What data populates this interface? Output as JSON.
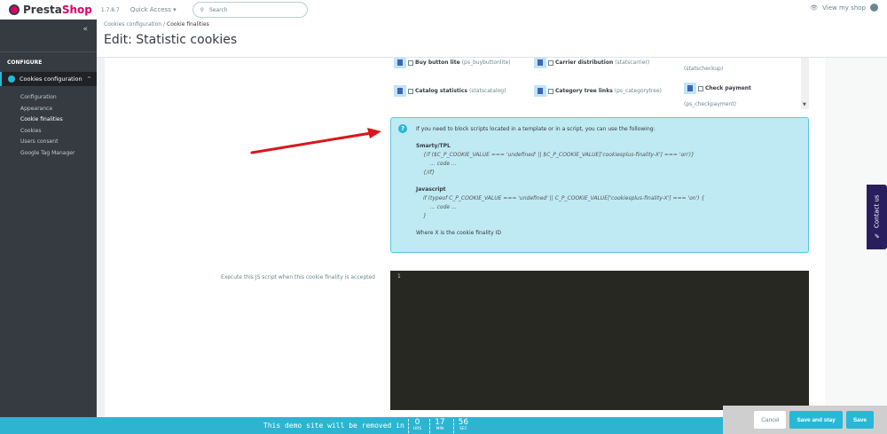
{
  "topbar": {
    "brand_a": "Presta",
    "brand_b": "Shop",
    "version": "1.7.8.7",
    "quick_access": "Quick Access ▾",
    "search_placeholder": "Search",
    "view_shop": "View my shop"
  },
  "sidebar": {
    "section": "CONFIGURE",
    "active": "Cookies configuration",
    "items": [
      "Configuration",
      "Appearance",
      "Cookie finalities",
      "Cookies",
      "Users consent",
      "Google Tag Manager"
    ]
  },
  "header": {
    "breadcrumb": [
      "Cookies configuration",
      "Cookie finalities"
    ],
    "title": "Edit: Statistic cookies"
  },
  "modules": [
    {
      "name": "Buy button lite",
      "code": "(ps_buybuttonlite)"
    },
    {
      "name": "Carrier distribution",
      "code": "(statscarrier)"
    },
    {
      "name": "",
      "code": "(statscheckup)"
    },
    {
      "name": "Catalog statistics",
      "code": "(statscatalog)"
    },
    {
      "name": "Category tree links",
      "code": "(ps_categorytree)"
    },
    {
      "name": "Check payment",
      "code": "(ps_checkpayment)"
    }
  ],
  "info": {
    "intro": "If you need to block scripts located in a template or in a script, you can use the following:",
    "smarty_title": "Smarty/TPL",
    "smarty_l1": "{if ($C_P_COOKIE_VALUE === 'undefined' || $C_P_COOKIE_VALUE['cookiesplus-finality-X'] === 'on')}",
    "smarty_l2": "... code ...",
    "smarty_l3": "{/if}",
    "js_title": "Javascript",
    "js_l1": "if (typeof C_P_COOKIE_VALUE === 'undefined' || C_P_COOKIE_VALUE['cookiesplus-finality-X'] === 'on') {",
    "js_l2": "... code ...",
    "js_l3": "}",
    "footer": "Where X is the cookie finality ID"
  },
  "form": {
    "js_label": "Execute this JS script when this cookie finality is accepted",
    "line_number": "1"
  },
  "contact": "Contact us",
  "demo": {
    "text": "This demo site will be removed in",
    "hrs": "0",
    "hrs_label": "HRS",
    "min": "17",
    "min_label": "MIN",
    "sec": "56",
    "sec_label": "SEC"
  },
  "actions": {
    "cancel": "Cancel",
    "save_stay": "Save and stay",
    "save": "Save"
  }
}
